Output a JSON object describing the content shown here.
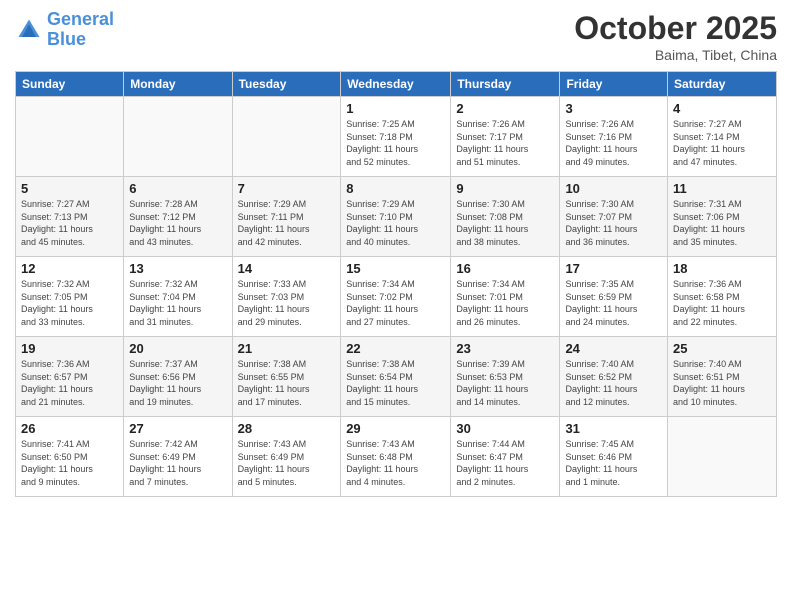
{
  "header": {
    "logo_line1": "General",
    "logo_line2": "Blue",
    "month": "October 2025",
    "location": "Baima, Tibet, China"
  },
  "weekdays": [
    "Sunday",
    "Monday",
    "Tuesday",
    "Wednesday",
    "Thursday",
    "Friday",
    "Saturday"
  ],
  "weeks": [
    [
      {
        "day": "",
        "info": ""
      },
      {
        "day": "",
        "info": ""
      },
      {
        "day": "",
        "info": ""
      },
      {
        "day": "1",
        "info": "Sunrise: 7:25 AM\nSunset: 7:18 PM\nDaylight: 11 hours\nand 52 minutes."
      },
      {
        "day": "2",
        "info": "Sunrise: 7:26 AM\nSunset: 7:17 PM\nDaylight: 11 hours\nand 51 minutes."
      },
      {
        "day": "3",
        "info": "Sunrise: 7:26 AM\nSunset: 7:16 PM\nDaylight: 11 hours\nand 49 minutes."
      },
      {
        "day": "4",
        "info": "Sunrise: 7:27 AM\nSunset: 7:14 PM\nDaylight: 11 hours\nand 47 minutes."
      }
    ],
    [
      {
        "day": "5",
        "info": "Sunrise: 7:27 AM\nSunset: 7:13 PM\nDaylight: 11 hours\nand 45 minutes."
      },
      {
        "day": "6",
        "info": "Sunrise: 7:28 AM\nSunset: 7:12 PM\nDaylight: 11 hours\nand 43 minutes."
      },
      {
        "day": "7",
        "info": "Sunrise: 7:29 AM\nSunset: 7:11 PM\nDaylight: 11 hours\nand 42 minutes."
      },
      {
        "day": "8",
        "info": "Sunrise: 7:29 AM\nSunset: 7:10 PM\nDaylight: 11 hours\nand 40 minutes."
      },
      {
        "day": "9",
        "info": "Sunrise: 7:30 AM\nSunset: 7:08 PM\nDaylight: 11 hours\nand 38 minutes."
      },
      {
        "day": "10",
        "info": "Sunrise: 7:30 AM\nSunset: 7:07 PM\nDaylight: 11 hours\nand 36 minutes."
      },
      {
        "day": "11",
        "info": "Sunrise: 7:31 AM\nSunset: 7:06 PM\nDaylight: 11 hours\nand 35 minutes."
      }
    ],
    [
      {
        "day": "12",
        "info": "Sunrise: 7:32 AM\nSunset: 7:05 PM\nDaylight: 11 hours\nand 33 minutes."
      },
      {
        "day": "13",
        "info": "Sunrise: 7:32 AM\nSunset: 7:04 PM\nDaylight: 11 hours\nand 31 minutes."
      },
      {
        "day": "14",
        "info": "Sunrise: 7:33 AM\nSunset: 7:03 PM\nDaylight: 11 hours\nand 29 minutes."
      },
      {
        "day": "15",
        "info": "Sunrise: 7:34 AM\nSunset: 7:02 PM\nDaylight: 11 hours\nand 27 minutes."
      },
      {
        "day": "16",
        "info": "Sunrise: 7:34 AM\nSunset: 7:01 PM\nDaylight: 11 hours\nand 26 minutes."
      },
      {
        "day": "17",
        "info": "Sunrise: 7:35 AM\nSunset: 6:59 PM\nDaylight: 11 hours\nand 24 minutes."
      },
      {
        "day": "18",
        "info": "Sunrise: 7:36 AM\nSunset: 6:58 PM\nDaylight: 11 hours\nand 22 minutes."
      }
    ],
    [
      {
        "day": "19",
        "info": "Sunrise: 7:36 AM\nSunset: 6:57 PM\nDaylight: 11 hours\nand 21 minutes."
      },
      {
        "day": "20",
        "info": "Sunrise: 7:37 AM\nSunset: 6:56 PM\nDaylight: 11 hours\nand 19 minutes."
      },
      {
        "day": "21",
        "info": "Sunrise: 7:38 AM\nSunset: 6:55 PM\nDaylight: 11 hours\nand 17 minutes."
      },
      {
        "day": "22",
        "info": "Sunrise: 7:38 AM\nSunset: 6:54 PM\nDaylight: 11 hours\nand 15 minutes."
      },
      {
        "day": "23",
        "info": "Sunrise: 7:39 AM\nSunset: 6:53 PM\nDaylight: 11 hours\nand 14 minutes."
      },
      {
        "day": "24",
        "info": "Sunrise: 7:40 AM\nSunset: 6:52 PM\nDaylight: 11 hours\nand 12 minutes."
      },
      {
        "day": "25",
        "info": "Sunrise: 7:40 AM\nSunset: 6:51 PM\nDaylight: 11 hours\nand 10 minutes."
      }
    ],
    [
      {
        "day": "26",
        "info": "Sunrise: 7:41 AM\nSunset: 6:50 PM\nDaylight: 11 hours\nand 9 minutes."
      },
      {
        "day": "27",
        "info": "Sunrise: 7:42 AM\nSunset: 6:49 PM\nDaylight: 11 hours\nand 7 minutes."
      },
      {
        "day": "28",
        "info": "Sunrise: 7:43 AM\nSunset: 6:49 PM\nDaylight: 11 hours\nand 5 minutes."
      },
      {
        "day": "29",
        "info": "Sunrise: 7:43 AM\nSunset: 6:48 PM\nDaylight: 11 hours\nand 4 minutes."
      },
      {
        "day": "30",
        "info": "Sunrise: 7:44 AM\nSunset: 6:47 PM\nDaylight: 11 hours\nand 2 minutes."
      },
      {
        "day": "31",
        "info": "Sunrise: 7:45 AM\nSunset: 6:46 PM\nDaylight: 11 hours\nand 1 minute."
      },
      {
        "day": "",
        "info": ""
      }
    ]
  ]
}
